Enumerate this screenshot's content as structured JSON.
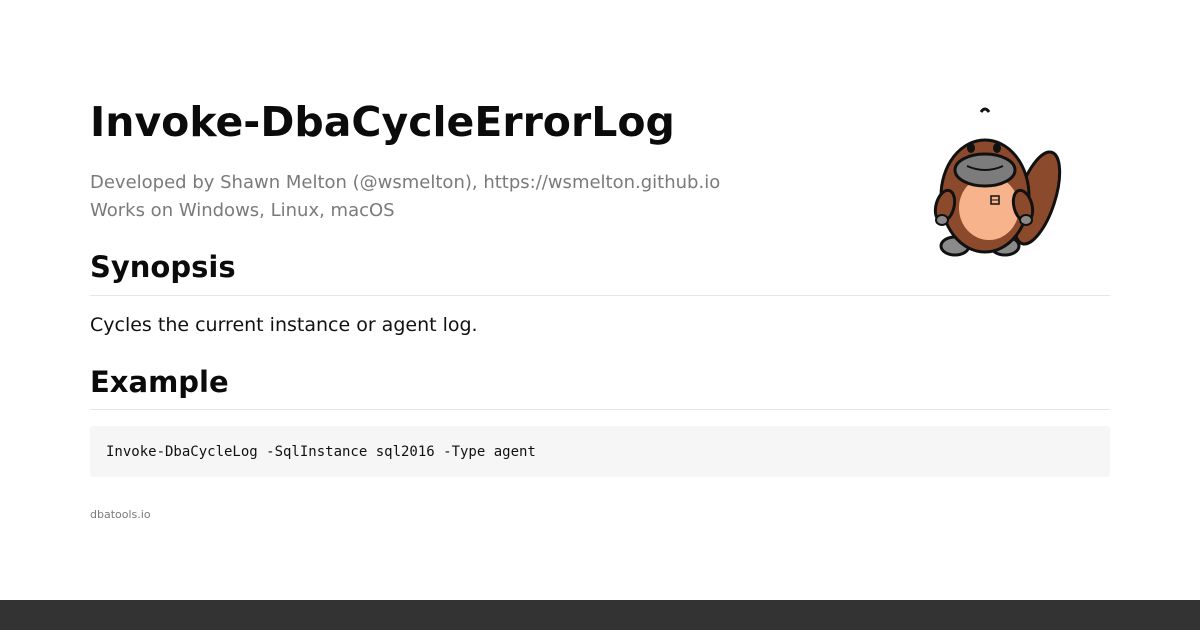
{
  "doc": {
    "title": "Invoke-DbaCycleErrorLog",
    "developed_by": "Developed by Shawn Melton (@wsmelton), https://wsmelton.github.io",
    "works_on": "Works on Windows, Linux, macOS",
    "sections": {
      "synopsis_heading": "Synopsis",
      "synopsis_text": "Cycles the current instance or agent log.",
      "example_heading": "Example",
      "example_code": "Invoke-DbaCycleLog -SqlInstance sql2016 -Type agent"
    },
    "site": "dbatools.io"
  },
  "mascot": {
    "icon": "platypus-mascot-icon",
    "body_color": "#8b4a2b",
    "belly_color": "#f7b48c",
    "bill_color": "#7c7c7c"
  },
  "footer": {
    "color": "#333333"
  }
}
